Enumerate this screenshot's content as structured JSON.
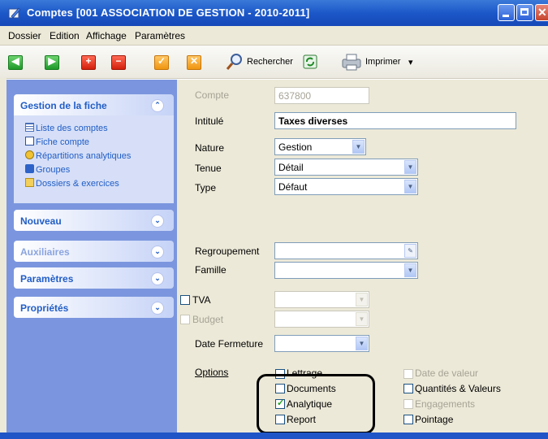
{
  "window": {
    "title": "Comptes [001 ASSOCIATION DE GESTION - 2010-2011]"
  },
  "menu": [
    "Dossier",
    "Edition",
    "Affichage",
    "Paramètres"
  ],
  "toolbar": {
    "search_label": "Rechercher",
    "print_label": "Imprimer",
    "print_arrow": "▾"
  },
  "sidebar": {
    "gestion": {
      "title": "Gestion de la fiche",
      "items": [
        "Liste des comptes",
        "Fiche compte",
        "Répartitions analytiques",
        "Groupes",
        "Dossiers & exercices"
      ]
    },
    "nouveau": "Nouveau",
    "auxiliaires": "Auxiliaires",
    "parametres": "Paramètres",
    "proprietes": "Propriétés",
    "chevron_up": "⌃",
    "chevron_down": "⌄"
  },
  "form": {
    "compte": {
      "label": "Compte",
      "value": "637800"
    },
    "intitule": {
      "label": "Intitulé",
      "value": "Taxes diverses"
    },
    "nature": {
      "label": "Nature",
      "value": "Gestion"
    },
    "tenue": {
      "label": "Tenue",
      "value": "Détail"
    },
    "type": {
      "label": "Type",
      "value": "Défaut"
    },
    "regroupement": {
      "label": "Regroupement",
      "value": ""
    },
    "famille": {
      "label": "Famille",
      "value": ""
    },
    "tva": {
      "label": "TVA",
      "checked": false
    },
    "budget": {
      "label": "Budget",
      "checked": false
    },
    "date_fermeture": {
      "label": "Date Fermeture",
      "value": ""
    },
    "options_label": "Options",
    "options": {
      "lettrage": {
        "label": "Lettrage",
        "checked": false
      },
      "documents": {
        "label": "Documents",
        "checked": false
      },
      "analytique": {
        "label": "Analytique",
        "checked": true
      },
      "report": {
        "label": "Report",
        "checked": false
      },
      "date_valeur": {
        "label": "Date de valeur",
        "checked": false
      },
      "quantites_valeurs": {
        "label": "Quantités & Valeurs",
        "checked": false
      },
      "engagements": {
        "label": "Engagements",
        "checked": false
      },
      "pointage": {
        "label": "Pointage",
        "checked": false
      }
    }
  },
  "colors": {
    "title_bar": "#1c58c9",
    "sidebar": "#7b96de",
    "panel_text": "#215dc6",
    "content_bg": "#ece9d8"
  }
}
